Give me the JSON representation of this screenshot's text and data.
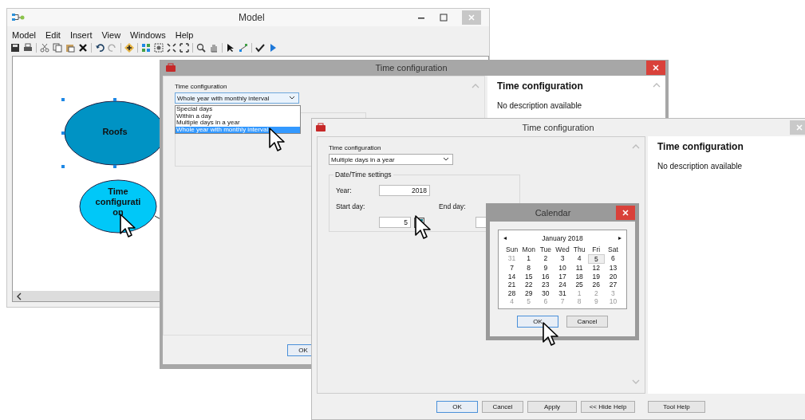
{
  "model_window": {
    "title": "Model",
    "menu": [
      "Model",
      "Edit",
      "Insert",
      "View",
      "Windows",
      "Help"
    ],
    "nodes": [
      {
        "label": "Roofs",
        "selected": true,
        "color": "#0093c4"
      },
      {
        "label": "Time configuration",
        "selected": false,
        "color": "#00c8f8"
      }
    ]
  },
  "dialog_back": {
    "title": "Time configuration",
    "field_label": "Time configuration",
    "select_value": "Whole year with monthly interval",
    "options": [
      {
        "label": "Special days",
        "selected": false
      },
      {
        "label": "Within a day",
        "selected": false
      },
      {
        "label": "Multiple days in a year",
        "selected": false
      },
      {
        "label": "Whole year with monthly interval",
        "selected": true
      }
    ],
    "help_title": "Time configuration",
    "help_text": "No description available",
    "button": "OK"
  },
  "dialog_front": {
    "title": "Time configuration",
    "field_label": "Time configuration",
    "select_value": "Multiple days in a year",
    "group_title": "Date/Time settings",
    "year_label": "Year:",
    "year": "2018",
    "start_label": "Start day:",
    "start_day": "5",
    "end_label": "End day:",
    "help_title": "Time configuration",
    "help_text": "No description available",
    "buttons": [
      "OK",
      "Cancel",
      "Apply",
      "<< Hide Help",
      "Tool Help"
    ]
  },
  "calendar": {
    "title": "Calendar",
    "month": "January 2018",
    "prev": "◂",
    "next": "▸",
    "weekdays": [
      "Sun",
      "Mon",
      "Tue",
      "Wed",
      "Thu",
      "Fri",
      "Sat"
    ],
    "weeks": [
      [
        {
          "d": "31",
          "other": true,
          "selected": false
        },
        {
          "d": "1",
          "other": false,
          "selected": false
        },
        {
          "d": "2",
          "other": false,
          "selected": false
        },
        {
          "d": "3",
          "other": false,
          "selected": false
        },
        {
          "d": "4",
          "other": false,
          "selected": false
        },
        {
          "d": "5",
          "other": false,
          "selected": true
        },
        {
          "d": "6",
          "other": false,
          "selected": false
        }
      ],
      [
        {
          "d": "7",
          "other": false,
          "selected": false
        },
        {
          "d": "8",
          "other": false,
          "selected": false
        },
        {
          "d": "9",
          "other": false,
          "selected": false
        },
        {
          "d": "10",
          "other": false,
          "selected": false
        },
        {
          "d": "11",
          "other": false,
          "selected": false
        },
        {
          "d": "12",
          "other": false,
          "selected": false
        },
        {
          "d": "13",
          "other": false,
          "selected": false
        }
      ],
      [
        {
          "d": "14",
          "other": false,
          "selected": false
        },
        {
          "d": "15",
          "other": false,
          "selected": false
        },
        {
          "d": "16",
          "other": false,
          "selected": false
        },
        {
          "d": "17",
          "other": false,
          "selected": false
        },
        {
          "d": "18",
          "other": false,
          "selected": false
        },
        {
          "d": "19",
          "other": false,
          "selected": false
        },
        {
          "d": "20",
          "other": false,
          "selected": false
        }
      ],
      [
        {
          "d": "21",
          "other": false,
          "selected": false
        },
        {
          "d": "22",
          "other": false,
          "selected": false
        },
        {
          "d": "23",
          "other": false,
          "selected": false
        },
        {
          "d": "24",
          "other": false,
          "selected": false
        },
        {
          "d": "25",
          "other": false,
          "selected": false
        },
        {
          "d": "26",
          "other": false,
          "selected": false
        },
        {
          "d": "27",
          "other": false,
          "selected": false
        }
      ],
      [
        {
          "d": "28",
          "other": false,
          "selected": false
        },
        {
          "d": "29",
          "other": false,
          "selected": false
        },
        {
          "d": "30",
          "other": false,
          "selected": false
        },
        {
          "d": "31",
          "other": false,
          "selected": false
        },
        {
          "d": "1",
          "other": true,
          "selected": false
        },
        {
          "d": "2",
          "other": true,
          "selected": false
        },
        {
          "d": "3",
          "other": true,
          "selected": false
        }
      ],
      [
        {
          "d": "4",
          "other": true,
          "selected": false
        },
        {
          "d": "5",
          "other": true,
          "selected": false
        },
        {
          "d": "6",
          "other": true,
          "selected": false
        },
        {
          "d": "7",
          "other": true,
          "selected": false
        },
        {
          "d": "8",
          "other": true,
          "selected": false
        },
        {
          "d": "9",
          "other": true,
          "selected": false
        },
        {
          "d": "10",
          "other": true,
          "selected": false
        }
      ]
    ],
    "buttons": [
      "OK",
      "Cancel"
    ]
  }
}
